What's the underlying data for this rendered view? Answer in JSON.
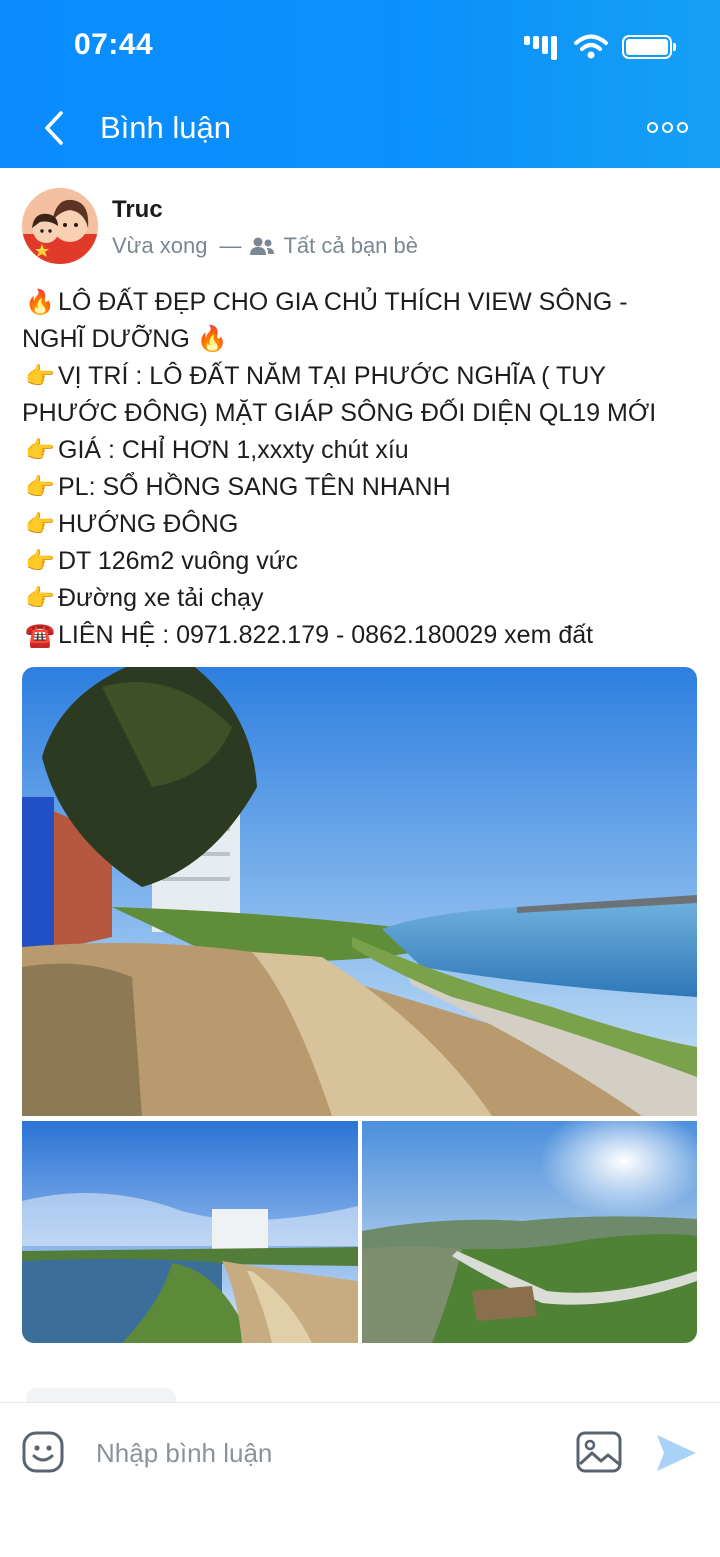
{
  "status_bar": {
    "time": "07:44"
  },
  "header": {
    "title": "Bình luận"
  },
  "post": {
    "author": "Truc",
    "time": "Vừa xong",
    "separator": "—",
    "privacy": "Tất cả bạn bè",
    "lines": [
      {
        "emoji": "🔥",
        "text": "LÔ ĐẤT ĐẸP CHO GIA CHỦ THÍCH VIEW SÔNG -"
      },
      {
        "emoji": "",
        "text": "NGHĨ DƯỠNG 🔥"
      },
      {
        "emoji": "👉",
        "text": "VỊ TRÍ : LÔ ĐẤT NĂM TẠI PHƯỚC NGHĨA ( TUY"
      },
      {
        "emoji": "",
        "text": "PHƯỚC ĐÔNG) MẶT GIÁP SÔNG ĐỐI DIỆN QL19 MỚI"
      },
      {
        "emoji": "👉",
        "text": "GIÁ : CHỈ HƠN 1,xxxty chút xíu"
      },
      {
        "emoji": "👉",
        "text": "PL: SỔ HỒNG SANG TÊN NHANH"
      },
      {
        "emoji": "👉",
        "text": "HƯỚNG ĐÔNG"
      },
      {
        "emoji": "👉",
        "text": "DT 126m2 vuông vức"
      },
      {
        "emoji": "👉",
        "text": "Đường xe tải chạy"
      },
      {
        "emoji": "☎️",
        "text": "LIÊN HỆ : 0971.822.179 - 0862.180029 xem đất"
      }
    ]
  },
  "comment": {
    "placeholder": "Nhập bình luận"
  },
  "colors": {
    "header": "#0a8cff",
    "send_icon": "#a9d2f7",
    "meta_text": "#7b8794"
  }
}
